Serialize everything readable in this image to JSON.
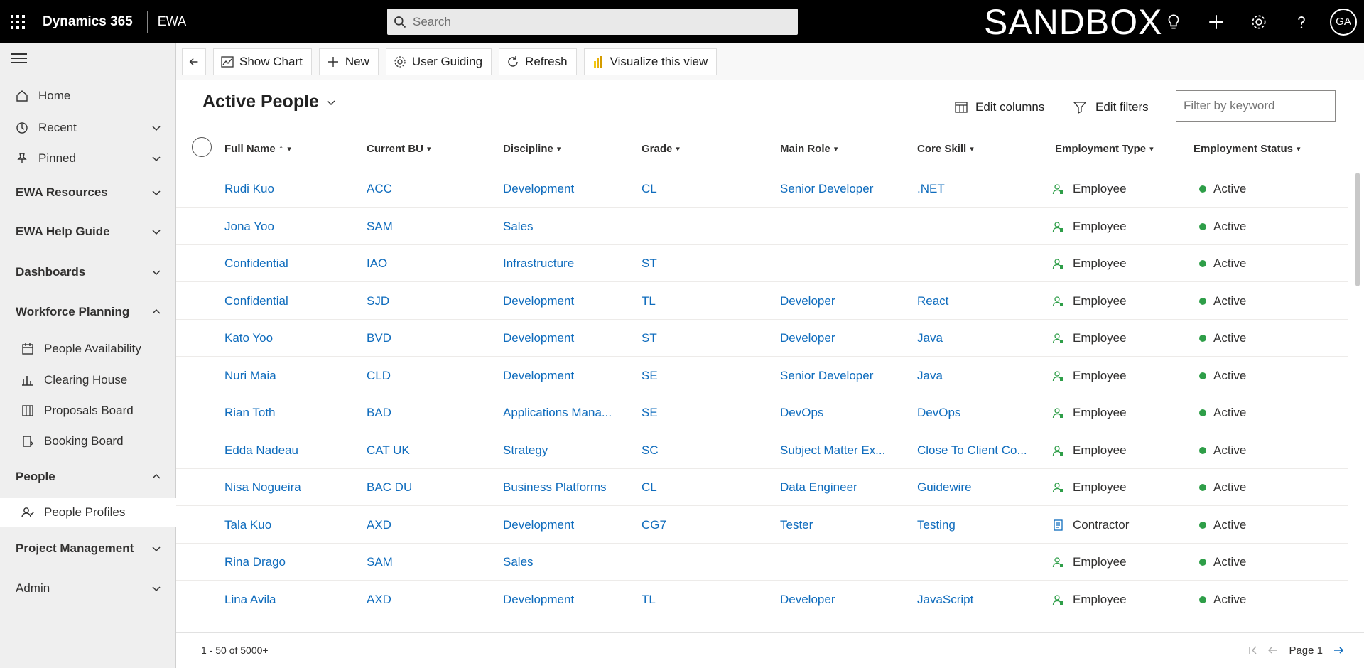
{
  "topbar": {
    "brand": "Dynamics 365",
    "app": "EWA",
    "search_placeholder": "Search",
    "environment": "SANDBOX",
    "user_initials": "GA"
  },
  "sidebar": {
    "items": [
      {
        "label": "Home",
        "kind": "item",
        "icon": "home-icon"
      },
      {
        "label": "Recent",
        "kind": "item",
        "icon": "clock-icon",
        "chevron": "down"
      },
      {
        "label": "Pinned",
        "kind": "item",
        "icon": "pin-icon",
        "chevron": "down"
      },
      {
        "label": "EWA Resources",
        "kind": "section",
        "chevron": "down"
      },
      {
        "label": "EWA Help Guide",
        "kind": "section",
        "chevron": "down"
      },
      {
        "label": "Dashboards",
        "kind": "section",
        "chevron": "down"
      },
      {
        "label": "Workforce Planning",
        "kind": "section",
        "chevron": "up"
      },
      {
        "label": "People Availability",
        "kind": "sub",
        "icon": "calendar-icon"
      },
      {
        "label": "Clearing House",
        "kind": "sub",
        "icon": "bar-chart-icon"
      },
      {
        "label": "Proposals Board",
        "kind": "sub",
        "icon": "board-icon"
      },
      {
        "label": "Booking Board",
        "kind": "sub",
        "icon": "book-icon"
      },
      {
        "label": "People",
        "kind": "section",
        "chevron": "up"
      },
      {
        "label": "People Profiles",
        "kind": "sub",
        "icon": "people-icon",
        "active": true
      },
      {
        "label": "Project Management",
        "kind": "section",
        "chevron": "down"
      },
      {
        "label": "Admin",
        "kind": "section",
        "chevron": "down"
      }
    ]
  },
  "commandbar": {
    "show_chart": "Show Chart",
    "new": "New",
    "user_guiding": "User Guiding",
    "refresh": "Refresh",
    "visualize": "Visualize this view"
  },
  "view": {
    "title": "Active People",
    "edit_columns": "Edit columns",
    "edit_filters": "Edit filters",
    "filter_placeholder": "Filter by keyword"
  },
  "columns": [
    {
      "key": "name",
      "label": "Full Name",
      "sort": "↑"
    },
    {
      "key": "bu",
      "label": "Current BU"
    },
    {
      "key": "discipline",
      "label": "Discipline"
    },
    {
      "key": "grade",
      "label": "Grade"
    },
    {
      "key": "role",
      "label": "Main Role"
    },
    {
      "key": "skill",
      "label": "Core Skill"
    },
    {
      "key": "type",
      "label": "Employment Type"
    },
    {
      "key": "status",
      "label": "Employment Status"
    }
  ],
  "rows": [
    {
      "name": "Rudi Kuo",
      "bu": "ACC",
      "discipline": "Development",
      "grade": "CL",
      "role": "Senior Developer",
      "skill": ".NET",
      "type": "Employee",
      "status": "Active"
    },
    {
      "name": "Jona Yoo",
      "bu": "SAM",
      "discipline": "Sales",
      "grade": "",
      "role": "",
      "skill": "",
      "type": "Employee",
      "status": "Active"
    },
    {
      "name": "Confidential",
      "bu": "IAO",
      "discipline": "Infrastructure",
      "grade": "ST",
      "role": "",
      "skill": "",
      "type": "Employee",
      "status": "Active"
    },
    {
      "name": "Confidential",
      "bu": "SJD",
      "discipline": "Development",
      "grade": "TL",
      "role": "Developer",
      "skill": "React",
      "type": "Employee",
      "status": "Active"
    },
    {
      "name": "Kato Yoo",
      "bu": "BVD",
      "discipline": "Development",
      "grade": "ST",
      "role": "Developer",
      "skill": "Java",
      "type": "Employee",
      "status": "Active"
    },
    {
      "name": "Nuri Maia",
      "bu": "CLD",
      "discipline": "Development",
      "grade": "SE",
      "role": "Senior Developer",
      "skill": "Java",
      "type": "Employee",
      "status": "Active"
    },
    {
      "name": "Rian Toth",
      "bu": "BAD",
      "discipline": "Applications Mana...",
      "grade": "SE",
      "role": "DevOps",
      "skill": "DevOps",
      "type": "Employee",
      "status": "Active"
    },
    {
      "name": "Edda Nadeau",
      "bu": "CAT UK",
      "discipline": "Strategy",
      "grade": "SC",
      "role": "Subject Matter Ex...",
      "skill": "Close To Client Co...",
      "type": "Employee",
      "status": "Active"
    },
    {
      "name": "Nisa Nogueira",
      "bu": "BAC DU",
      "discipline": "Business Platforms",
      "grade": "CL",
      "role": "Data Engineer",
      "skill": "Guidewire",
      "type": "Employee",
      "status": "Active"
    },
    {
      "name": "Tala Kuo",
      "bu": "AXD",
      "discipline": "Development",
      "grade": "CG7",
      "role": "Tester",
      "skill": "Testing",
      "type": "Contractor",
      "status": "Active"
    },
    {
      "name": "Rina Drago",
      "bu": "SAM",
      "discipline": "Sales",
      "grade": "",
      "role": "",
      "skill": "",
      "type": "Employee",
      "status": "Active"
    },
    {
      "name": "Lina Avila",
      "bu": "AXD",
      "discipline": "Development",
      "grade": "TL",
      "role": "Developer",
      "skill": "JavaScript",
      "type": "Employee",
      "status": "Active"
    }
  ],
  "footer": {
    "record_count": "1 - 50 of 5000+",
    "page_label": "Page 1"
  }
}
